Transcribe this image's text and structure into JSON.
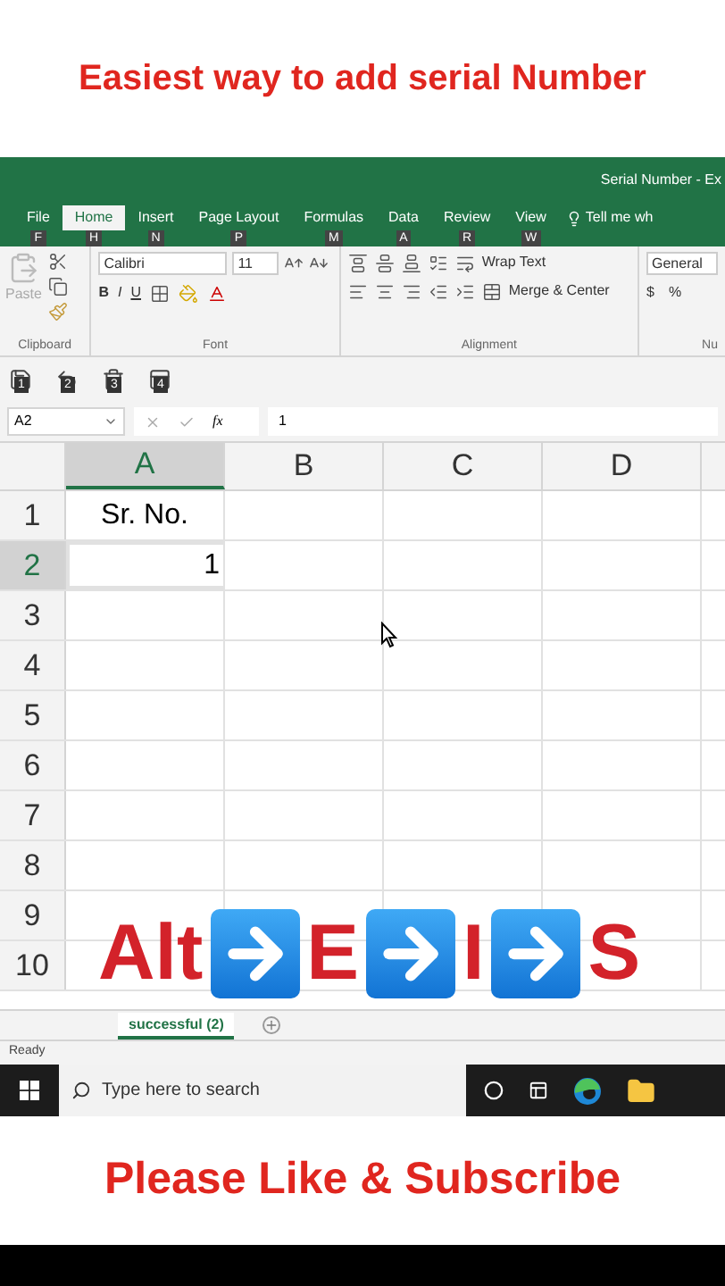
{
  "video_title": "Easiest way to add serial Number",
  "excel": {
    "window_title": "Serial Number - Ex",
    "tabs": [
      {
        "label": "File",
        "keytip": "F",
        "selected": false
      },
      {
        "label": "Home",
        "keytip": "H",
        "selected": true
      },
      {
        "label": "Insert",
        "keytip": "N",
        "selected": false
      },
      {
        "label": "Page Layout",
        "keytip": "P",
        "selected": false
      },
      {
        "label": "Formulas",
        "keytip": "M",
        "selected": false
      },
      {
        "label": "Data",
        "keytip": "A",
        "selected": false
      },
      {
        "label": "Review",
        "keytip": "R",
        "selected": false
      },
      {
        "label": "View",
        "keytip": "W",
        "selected": false
      }
    ],
    "tell_me": "Tell me wh",
    "ribbon": {
      "paste": "Paste",
      "font_name": "Calibri",
      "font_size": "11",
      "bold": "B",
      "italic": "I",
      "underline": "U",
      "wrap_text": "Wrap Text",
      "merge": "Merge & Center",
      "number_format": "General",
      "currency": "$",
      "percent": "%",
      "groups": [
        "Clipboard",
        "Font",
        "Alignment",
        "Nu"
      ]
    },
    "quick_access": [
      "1",
      "2",
      "3",
      "4"
    ],
    "name_box": "A2",
    "fx": "fx",
    "formula": "1",
    "columns": [
      {
        "label": "A",
        "selected": true
      },
      {
        "label": "B",
        "selected": false
      },
      {
        "label": "C",
        "selected": false
      },
      {
        "label": "D",
        "selected": false
      }
    ],
    "rows": [
      {
        "number": "1",
        "selected": false,
        "value": "Sr. No.",
        "kind": "text"
      },
      {
        "number": "2",
        "selected": true,
        "value": "1",
        "kind": "number"
      },
      {
        "number": "3",
        "selected": false
      },
      {
        "number": "4",
        "selected": false
      },
      {
        "number": "5",
        "selected": false
      },
      {
        "number": "6",
        "selected": false
      },
      {
        "number": "7",
        "selected": false
      },
      {
        "number": "8",
        "selected": false
      },
      {
        "number": "9",
        "selected": false
      },
      {
        "number": "10",
        "selected": false
      }
    ],
    "sheet_tab": {
      "label": "successful (2)",
      "selected": true
    },
    "status": "Ready",
    "search_placeholder": "Type here to search"
  },
  "overlay_keys": [
    {
      "kind": "text",
      "label": "Alt"
    },
    {
      "kind": "arrow"
    },
    {
      "kind": "text",
      "label": "E"
    },
    {
      "kind": "arrow"
    },
    {
      "kind": "text",
      "label": "I"
    },
    {
      "kind": "arrow"
    },
    {
      "kind": "text",
      "label": "S"
    }
  ],
  "footer": "Please Like & Subscribe"
}
